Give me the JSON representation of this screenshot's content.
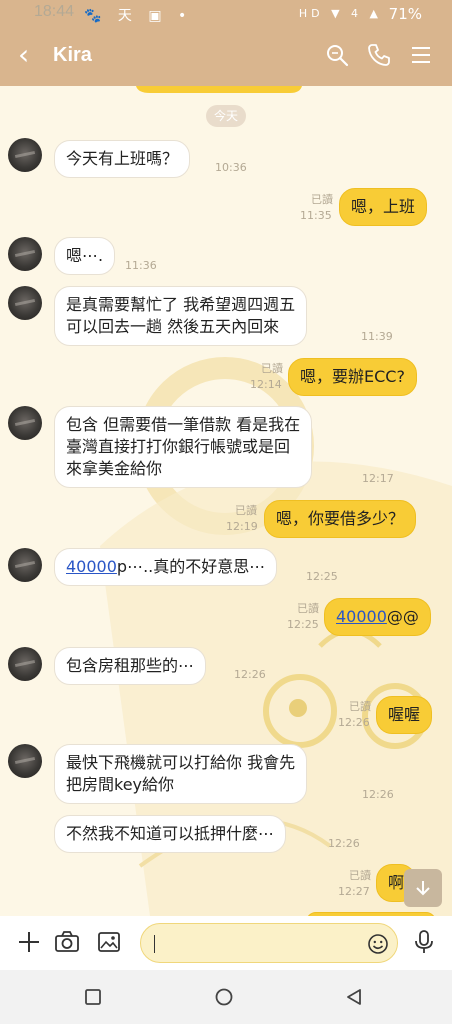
{
  "status_bar": {
    "time": "18:44",
    "left_icons": "🐾 天 ▣ •",
    "right_icons": "HD ▼ 4 ▲",
    "battery": "71%"
  },
  "header": {
    "back_glyph": "‹",
    "contact_name": "Kira"
  },
  "chat": {
    "date_label": "今天",
    "read_label": "已讀",
    "messages": [
      {
        "side": "in",
        "avatar": true,
        "text": "今天有上班嗎？",
        "time": "10:36"
      },
      {
        "side": "out",
        "text": "嗯，上班",
        "time": "11:35",
        "read": true
      },
      {
        "side": "in",
        "avatar": true,
        "text": "嗯⋯.",
        "time": "11:36"
      },
      {
        "side": "in",
        "avatar": true,
        "lines": [
          "是真需要幫忙了 我希望週四週五",
          "可以回去一趟 然後五天內回來"
        ],
        "time": "11:39"
      },
      {
        "side": "out",
        "text": "嗯，要辦ECC?",
        "time": "12:14",
        "read": true
      },
      {
        "side": "in",
        "avatar": true,
        "lines": [
          "包含 但需要借一筆借款 看是我在",
          "臺灣直接打打你銀行帳號或是回",
          "來拿美金給你"
        ],
        "time": "12:17"
      },
      {
        "side": "out",
        "text": "嗯，你要借多少？",
        "time": "12:19",
        "read": true
      },
      {
        "side": "in",
        "avatar": true,
        "link": "40000",
        "text": "p⋯..真的不好意思⋯",
        "time": "12:25"
      },
      {
        "side": "out",
        "link": "40000",
        "text": "@@",
        "time": "12:25",
        "read": true
      },
      {
        "side": "in",
        "avatar": true,
        "text": "包含房租那些的⋯",
        "time": "12:26"
      },
      {
        "side": "out",
        "text": "喔喔",
        "time": "12:26",
        "read": true
      },
      {
        "side": "in",
        "avatar": true,
        "lines": [
          "最快下飛機就可以打給你 我會先",
          "把房間key給你"
        ],
        "time": "12:26"
      },
      {
        "side": "in",
        "avatar": false,
        "text": "不然我不知道可以抵押什麼⋯",
        "time": "12:26"
      },
      {
        "side": "out",
        "text": "啊",
        "time": "12:27",
        "read": true
      }
    ]
  },
  "composer": {
    "placeholder": ""
  },
  "colors": {
    "header": "#d9b58e",
    "outgoing_bubble": "#f8cc36",
    "background": "#fdf7e6",
    "link": "#2a56c6"
  }
}
